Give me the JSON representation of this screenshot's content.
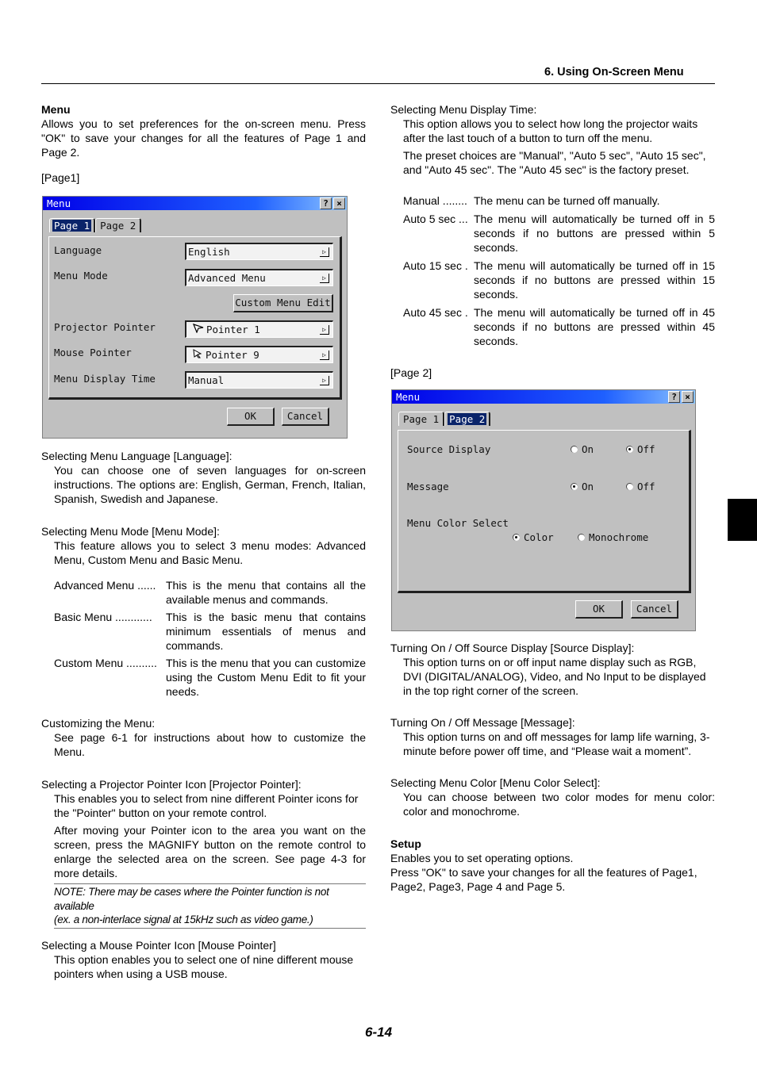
{
  "header": {
    "section_title": "6. Using On-Screen Menu"
  },
  "footer": {
    "page_number": "6-14"
  },
  "left_column": {
    "menu_heading": "Menu",
    "menu_intro": "Allows you to set preferences for the on-screen menu. Press \"OK\" to save your changes for all the features of Page 1 and Page 2.",
    "page1_label": "[Page1]",
    "language_heading": "Selecting Menu Language [Language]:",
    "language_body": "You can choose one of seven languages for on-screen instructions. The options are: English, German, French, Italian, Spanish, Swedish and Japanese.",
    "menu_mode_heading": "Selecting Menu Mode [Menu Mode]:",
    "menu_mode_body": "This feature allows you to select 3 menu modes: Advanced Menu, Custom Menu and Basic Menu.",
    "menu_modes": [
      {
        "term": "Advanced Menu ......",
        "desc": "This is the menu that contains all the available menus and commands."
      },
      {
        "term": "Basic Menu ............",
        "desc": "This is the basic menu that contains minimum essentials of menus and commands."
      },
      {
        "term": "Custom Menu ..........",
        "desc": "This is the menu that you can customize using the Custom Menu Edit to fit your needs."
      }
    ],
    "customizing_heading": "Customizing the Menu:",
    "customizing_body": "See page 6-1 for instructions about how to customize the Menu.",
    "proj_pointer_heading": "Selecting a Projector Pointer Icon [Projector Pointer]:",
    "proj_pointer_body1": "This enables you to select from nine different Pointer icons for the \"Pointer\" button on your remote control.",
    "proj_pointer_body2": "After moving your Pointer icon to the area you want on the screen, press the MAGNIFY button on the remote control to enlarge the selected area on the screen. See page 4-3 for more details.",
    "note_line1": "NOTE: There may be cases where the Pointer function is not available",
    "note_line2": "(ex. a non-interlace signal at 15kHz such as video game.)",
    "mouse_pointer_heading": "Selecting a Mouse Pointer Icon [Mouse Pointer]",
    "mouse_pointer_body": "This option enables you to select one of nine different mouse pointers when using a USB mouse."
  },
  "right_column": {
    "display_time_heading": "Selecting Menu Display Time:",
    "display_time_body1": "This option allows you to select how long the projector waits after the last touch of a button to turn off the menu.",
    "display_time_body2": "The preset choices are \"Manual\", \"Auto 5 sec\", \"Auto 15 sec\", and \"Auto 45 sec\". The \"Auto 45 sec\" is the factory preset.",
    "display_times": [
      {
        "term": "Manual ........",
        "desc": "The menu can be turned off manually."
      },
      {
        "term": "Auto 5 sec ...",
        "desc": "The menu will automatically be turned off in 5 seconds if no buttons are pressed within 5 seconds."
      },
      {
        "term": "Auto 15 sec .",
        "desc": "The menu will automatically be turned off in 15 seconds if no buttons are pressed within 15 seconds."
      },
      {
        "term": "Auto 45 sec .",
        "desc": "The menu will automatically be turned off in 45 seconds if no buttons are pressed within 45 seconds."
      }
    ],
    "page2_label": "[Page 2]",
    "source_display_heading": "Turning On / Off Source Display [Source Display]:",
    "source_display_body": "This option turns on or off input name display such as RGB, DVI (DIGITAL/ANALOG), Video, and No Input to be displayed in the top right corner of the screen.",
    "message_heading": "Turning On / Off Message [Message]:",
    "message_body": "This option turns on and off messages for lamp life warning, 3-minute before power off time, and “Please wait a moment”.",
    "color_heading": "Selecting Menu Color [Menu Color Select]:",
    "color_body": "You can choose between two color modes for menu color: color and monochrome.",
    "setup_heading": "Setup",
    "setup_body1": "Enables you to set operating options.",
    "setup_body2": "Press \"OK\" to save your changes for all the features of Page1, Page2, Page3, Page 4 and Page 5."
  },
  "dialog1": {
    "title": "Menu",
    "help_label": "?",
    "close_label": "×",
    "tabs": [
      "Page 1",
      "Page 2"
    ],
    "active_tab": "Page 1",
    "fields": [
      {
        "label": "Language",
        "value": "English"
      },
      {
        "label": "Menu Mode",
        "value": "Advanced Menu"
      },
      {
        "label": "Projector Pointer",
        "value": "Pointer 1",
        "icon": "pointer-arrow-icon"
      },
      {
        "label": "Mouse Pointer",
        "value": "Pointer 9",
        "icon": "pointer-cursor-icon"
      },
      {
        "label": "Menu Display Time",
        "value": "Manual"
      }
    ],
    "custom_menu_edit_label": "Custom Menu Edit",
    "ok_label": "OK",
    "cancel_label": "Cancel",
    "arrow_glyph": "▷"
  },
  "dialog2": {
    "title": "Menu",
    "help_label": "?",
    "close_label": "×",
    "tabs": [
      "Page 1",
      "Page 2"
    ],
    "active_tab": "Page 2",
    "source_display": {
      "label": "Source Display",
      "on_label": "On",
      "off_label": "Off",
      "selected": "Off"
    },
    "message": {
      "label": "Message",
      "on_label": "On",
      "off_label": "Off",
      "selected": "On"
    },
    "menu_color": {
      "label": "Menu Color Select",
      "color_label": "Color",
      "mono_label": "Monochrome",
      "selected": "Color"
    },
    "ok_label": "OK",
    "cancel_label": "Cancel"
  }
}
